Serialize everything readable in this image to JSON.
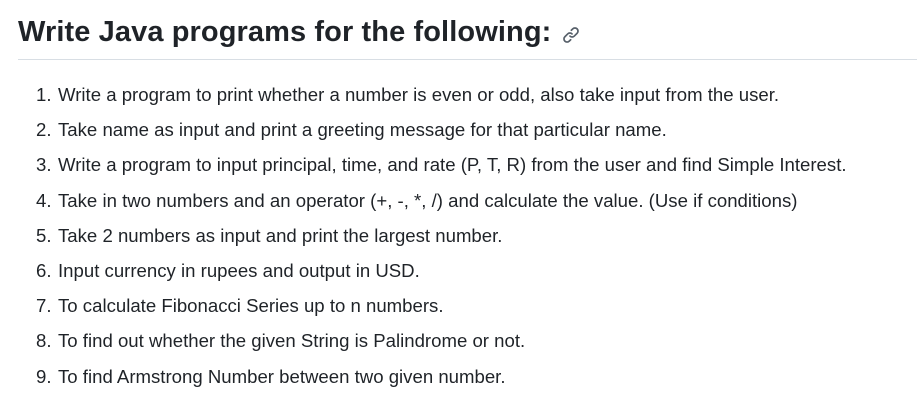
{
  "heading": {
    "title": "Write Java programs for the following:",
    "anchor_icon": "link-icon",
    "anchor_color": "#57606a"
  },
  "items": [
    {
      "number": "1.",
      "text": "Write a program to print whether a number is even or odd, also take input from the user."
    },
    {
      "number": "2.",
      "text": "Take name as input and print a greeting message for that particular name."
    },
    {
      "number": "3.",
      "text": "Write a program to input principal, time, and rate (P, T, R) from the user and find Simple Interest."
    },
    {
      "number": "4.",
      "text": "Take in two numbers and an operator (+, -, *, /) and calculate the value. (Use if conditions)"
    },
    {
      "number": "5.",
      "text": "Take 2 numbers as input and print the largest number."
    },
    {
      "number": "6.",
      "text": "Input currency in rupees and output in USD."
    },
    {
      "number": "7.",
      "text": "To calculate Fibonacci Series up to n numbers."
    },
    {
      "number": "8.",
      "text": "To find out whether the given String is Palindrome or not."
    },
    {
      "number": "9.",
      "text": "To find Armstrong Number between two given number."
    }
  ]
}
